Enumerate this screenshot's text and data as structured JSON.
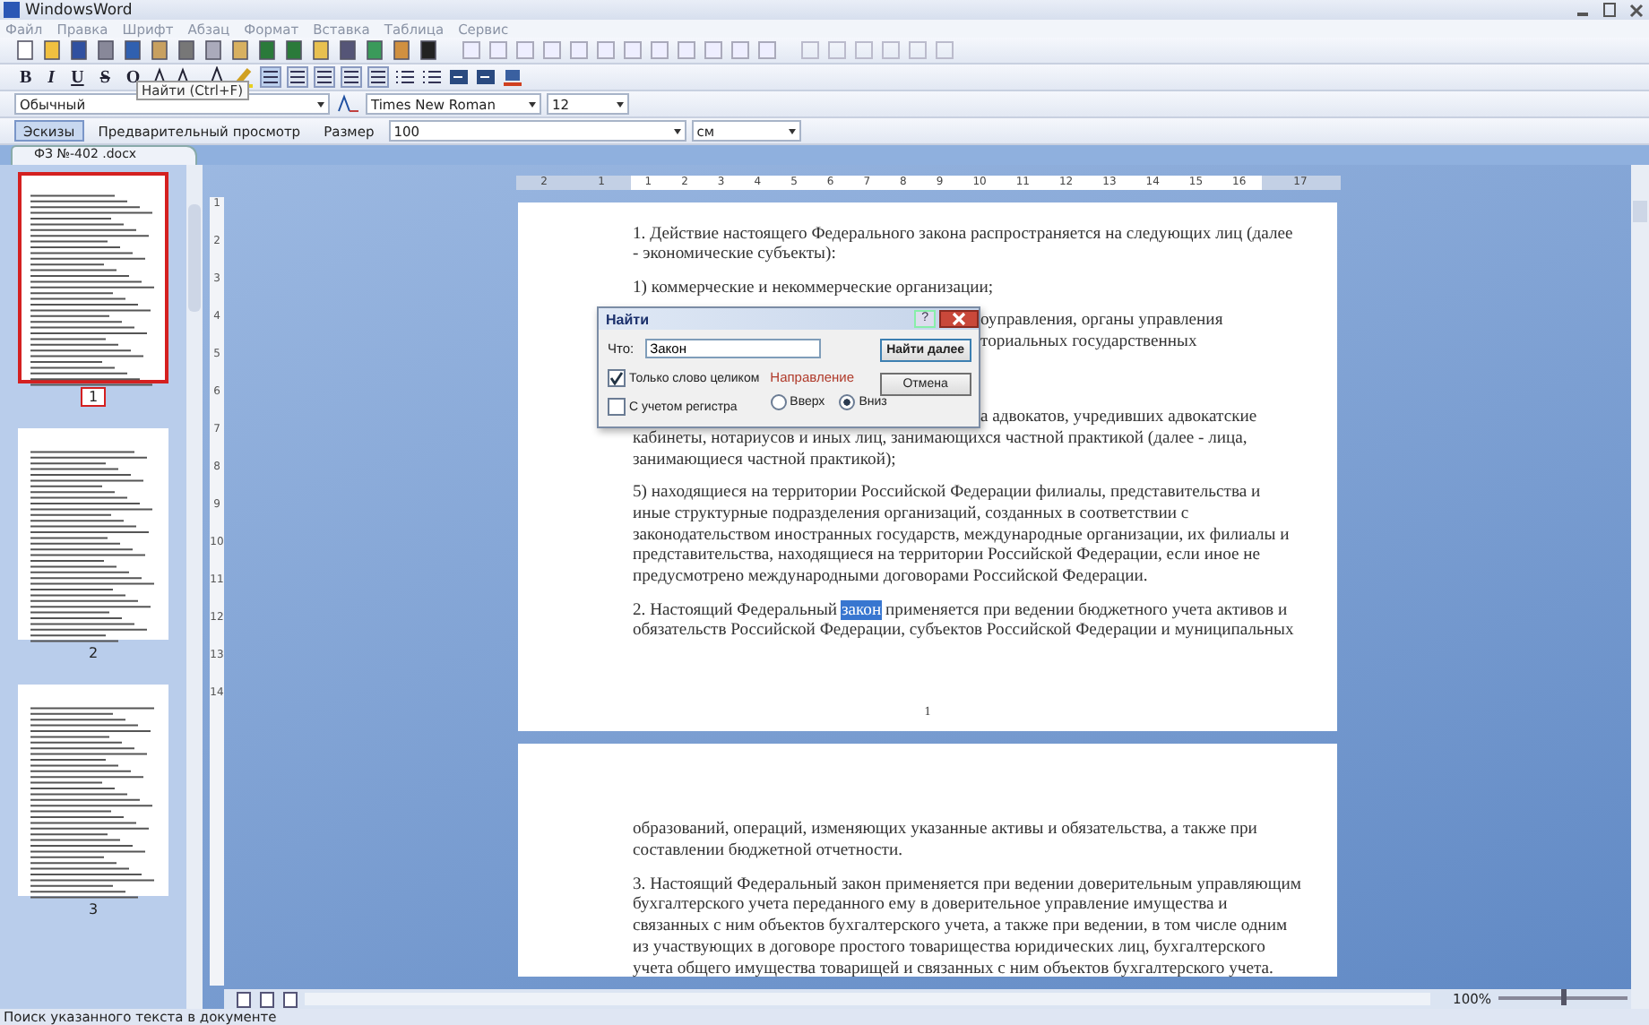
{
  "window": {
    "title": "WindowsWord"
  },
  "menu": [
    {
      "label": "Файл"
    },
    {
      "label": "Правка"
    },
    {
      "label": "Шрифт"
    },
    {
      "label": "Абзац"
    },
    {
      "label": "Формат"
    },
    {
      "label": "Вставка"
    },
    {
      "label": "Таблица"
    },
    {
      "label": "Сервис"
    }
  ],
  "format_buttons": [
    "B",
    "I",
    "U",
    "S",
    "O"
  ],
  "tooltip": "Найти (Ctrl+F)",
  "style_select": "Обычный",
  "font_select": "Times New Roman",
  "size_select": "12",
  "view_bar": {
    "thumbnails_button": {
      "label": "Эскизы",
      "selected": true
    },
    "preview_button": "Предварительный просмотр",
    "size_label": "Размер",
    "zoom_select": "100",
    "unit_select": "см"
  },
  "document_tab": "ФЗ №-402 .docx",
  "thumbnails": [
    {
      "page": "1",
      "selected": true
    },
    {
      "page": "2",
      "selected": false
    },
    {
      "page": "3",
      "selected": false
    }
  ],
  "ruler": {
    "left_labels": [
      "2",
      "1"
    ],
    "labels": [
      "1",
      "2",
      "3",
      "4",
      "5",
      "6",
      "7",
      "8",
      "9",
      "10",
      "11",
      "12",
      "13",
      "14",
      "15",
      "16"
    ],
    "right_labels": [
      "17"
    ]
  },
  "vertical_ruler": [
    "1",
    "2",
    "3",
    "4",
    "5",
    "6",
    "7",
    "8",
    "9",
    "10",
    "11",
    "12",
    "13",
    "14"
  ],
  "pages": [
    {
      "number": "1",
      "paragraphs": [
        {
          "kind": "full",
          "lines": [
            [
              {
                "text": "1. Действие настоящего Федерального закона распространяется на следующих лиц (далее"
              }
            ],
            [
              {
                "text": "- экономические субъекты):"
              }
            ]
          ]
        },
        {
          "kind": "full",
          "lines": [
            [
              {
                "text": "1) коммерческие и некоммерческие организации;"
              }
            ]
          ]
        },
        {
          "kind": "covered-end",
          "lines": [
            [
              {
                "text": "оуправления, органы управления"
              }
            ],
            [
              {
                "text": "ториальных государственных"
              }
            ]
          ]
        },
        {
          "kind": "covered-start",
          "lines": [
            [
              {
                "text": "а адвокатов, учредивших адвокатские"
              }
            ],
            [
              {
                "text": "кабинеты, нотариусов и иных лиц, занимающихся частной практикой (далее - лица,"
              }
            ],
            [
              {
                "text": "занимающиеся частной практикой);"
              }
            ]
          ]
        },
        {
          "kind": "full",
          "lines": [
            [
              {
                "text": "5) находящиеся на территории Российской Федерации филиалы, представительства и"
              }
            ],
            [
              {
                "text": "иные структурные подразделения организаций, созданных в соответствии с"
              }
            ],
            [
              {
                "text": "законодательством иностранных государств, международные организации, их филиалы и"
              }
            ],
            [
              {
                "text": "представительства, находящиеся на территории Российской Федерации, если иное не"
              }
            ],
            [
              {
                "text": "предусмотрено международными договорами Российской Федерации."
              }
            ]
          ]
        },
        {
          "kind": "full",
          "lines": [
            [
              {
                "text": "2. Настоящий Федеральный ",
                "selected": false
              },
              {
                "text": "закон",
                "selected": true
              },
              {
                "text": " применяется при ведении бюджетного учета активов и",
                "selected": false
              }
            ],
            [
              {
                "text": "обязательств Российской Федерации, субъектов Российской Федерации и муниципальных"
              }
            ]
          ]
        }
      ]
    },
    {
      "paragraphs": [
        {
          "kind": "full",
          "lines": [
            [
              {
                "text": "образований, операций, изменяющих указанные активы и обязательства, а также при"
              }
            ],
            [
              {
                "text": "составлении бюджетной отчетности."
              }
            ]
          ]
        },
        {
          "kind": "full",
          "lines": [
            [
              {
                "text": "3. Настоящий Федеральный закон применяется при ведении доверительным управляющим"
              }
            ],
            [
              {
                "text": "бухгалтерского учета переданного ему в доверительное управление имущества и"
              }
            ],
            [
              {
                "text": "связанных с ним объектов бухгалтерского учета, а также при ведении, в том числе одним"
              }
            ],
            [
              {
                "text": "из участвующих в договоре простого товарищества юридических лиц, бухгалтерского"
              }
            ],
            [
              {
                "text": "учета общего имущества товарищей и связанных с ним объектов бухгалтерского учета."
              }
            ]
          ]
        }
      ]
    }
  ],
  "find_dialog": {
    "title": "Найти",
    "help": "?",
    "what_label": "Что:",
    "query": "Закон",
    "find_next": "Найти далее",
    "cancel": "Отмена",
    "options": [
      {
        "label": "Только слово целиком",
        "checked": true
      },
      {
        "label": "С учетом регистра",
        "checked": false
      }
    ],
    "direction_label": "Направление",
    "directions": [
      {
        "label": "Вверх",
        "selected": false
      },
      {
        "label": "Вниз",
        "selected": true
      }
    ]
  },
  "zoom": {
    "reading": "100%",
    "level": 0.5
  },
  "status_bar": "Поиск указанного текста в документе"
}
